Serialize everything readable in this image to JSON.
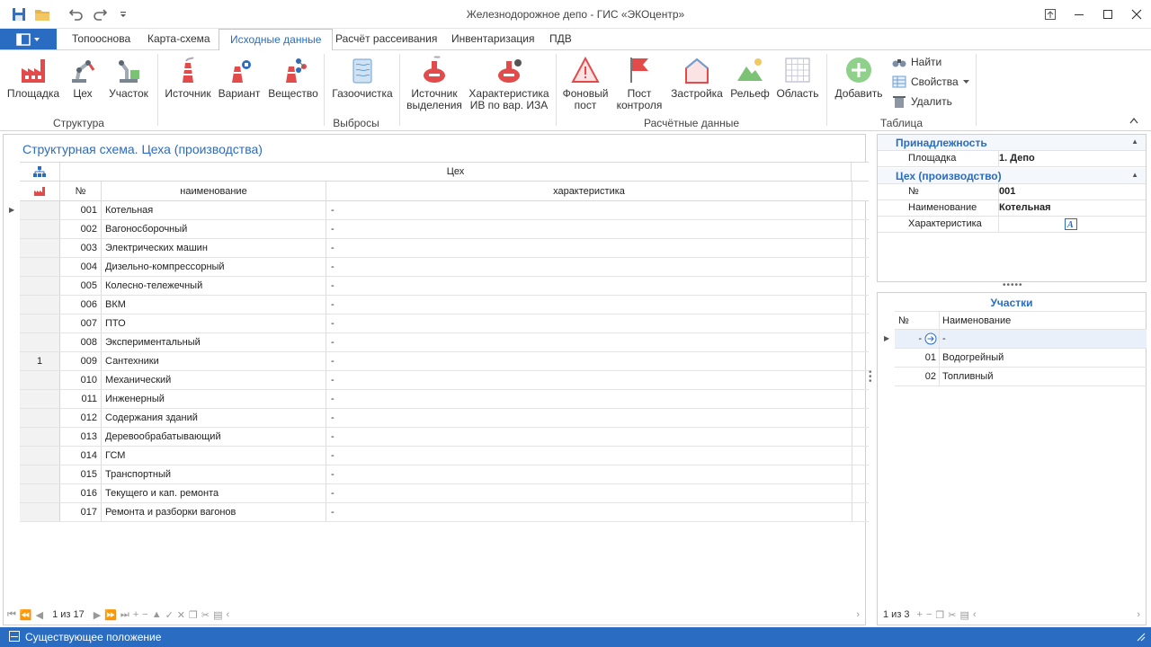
{
  "window": {
    "title": "Железнодорожное депо - ГИС «ЭКОцентр»"
  },
  "ribbon_tabs": [
    "Топооснова",
    "Карта-схема",
    "Исходные данные",
    "Расчёт рассеивания",
    "Инвентаризация",
    "ПДВ"
  ],
  "active_tab": "Исходные данные",
  "ribbon": {
    "structure": {
      "group_label": "Структура",
      "buttons": [
        "Площадка",
        "Цех",
        "Участок"
      ]
    },
    "emissions": {
      "group_label": "Выбросы",
      "buttons": [
        "Источник",
        "Вариант",
        "Вещество",
        "Газоочистка",
        "Источник\nвыделения",
        "Характеристика\nИВ по вар. ИЗА"
      ]
    },
    "calc": {
      "group_label": "Расчётные данные",
      "buttons": [
        "Фоновый\nпост",
        "Пост\nконтроля",
        "Застройка",
        "Рельеф",
        "Область"
      ]
    },
    "table": {
      "group_label": "Таблица",
      "add": "Добавить",
      "find": "Найти",
      "properties": "Свойства",
      "delete": "Удалить"
    }
  },
  "main": {
    "title": "Структурная схема. Цеха (производства)",
    "band_header": "Цех",
    "columns": {
      "num": "№",
      "name": "наименование",
      "char": "характеристика"
    },
    "group_value": "1",
    "rows": [
      {
        "num": "001",
        "name": "Котельная",
        "char": "-"
      },
      {
        "num": "002",
        "name": "Вагоносборочный",
        "char": "-"
      },
      {
        "num": "003",
        "name": "Электрических машин",
        "char": "-"
      },
      {
        "num": "004",
        "name": "Дизельно-компрессорный",
        "char": "-"
      },
      {
        "num": "005",
        "name": "Колесно-тележечный",
        "char": "-"
      },
      {
        "num": "006",
        "name": "ВКМ",
        "char": "-"
      },
      {
        "num": "007",
        "name": "ПТО",
        "char": "-"
      },
      {
        "num": "008",
        "name": "Экспериментальный",
        "char": "-"
      },
      {
        "num": "009",
        "name": "Сантехники",
        "char": "-"
      },
      {
        "num": "010",
        "name": "Механический",
        "char": "-"
      },
      {
        "num": "011",
        "name": "Инженерный",
        "char": "-"
      },
      {
        "num": "012",
        "name": "Содержания зданий",
        "char": "-"
      },
      {
        "num": "013",
        "name": "Деревообрабатывающий",
        "char": "-"
      },
      {
        "num": "014",
        "name": "ГСМ",
        "char": "-"
      },
      {
        "num": "015",
        "name": "Транспортный",
        "char": "-"
      },
      {
        "num": "016",
        "name": "Текущего и кап. ремонта",
        "char": "-"
      },
      {
        "num": "017",
        "name": "Ремонта и разборки вагонов",
        "char": "-"
      }
    ],
    "pager": "1 из 17"
  },
  "properties": {
    "section1": "Принадлежность",
    "platform_label": "Площадка",
    "platform_value": "1. Депо",
    "section2": "Цех (производство)",
    "num_label": "№",
    "num_value": "001",
    "name_label": "Наименование",
    "name_value": "Котельная",
    "char_label": "Характеристика"
  },
  "sections_panel": {
    "title": "Участки",
    "col_num": "№",
    "col_name": "Наименование",
    "rows": [
      {
        "num": "-",
        "name": "-"
      },
      {
        "num": "01",
        "name": "Водогрейный"
      },
      {
        "num": "02",
        "name": "Топливный"
      }
    ],
    "pager": "1 из 3"
  },
  "status": {
    "text": "Существующее положение"
  },
  "colors": {
    "accent": "#2a6cc2",
    "icon_red": "#e34b4b"
  }
}
